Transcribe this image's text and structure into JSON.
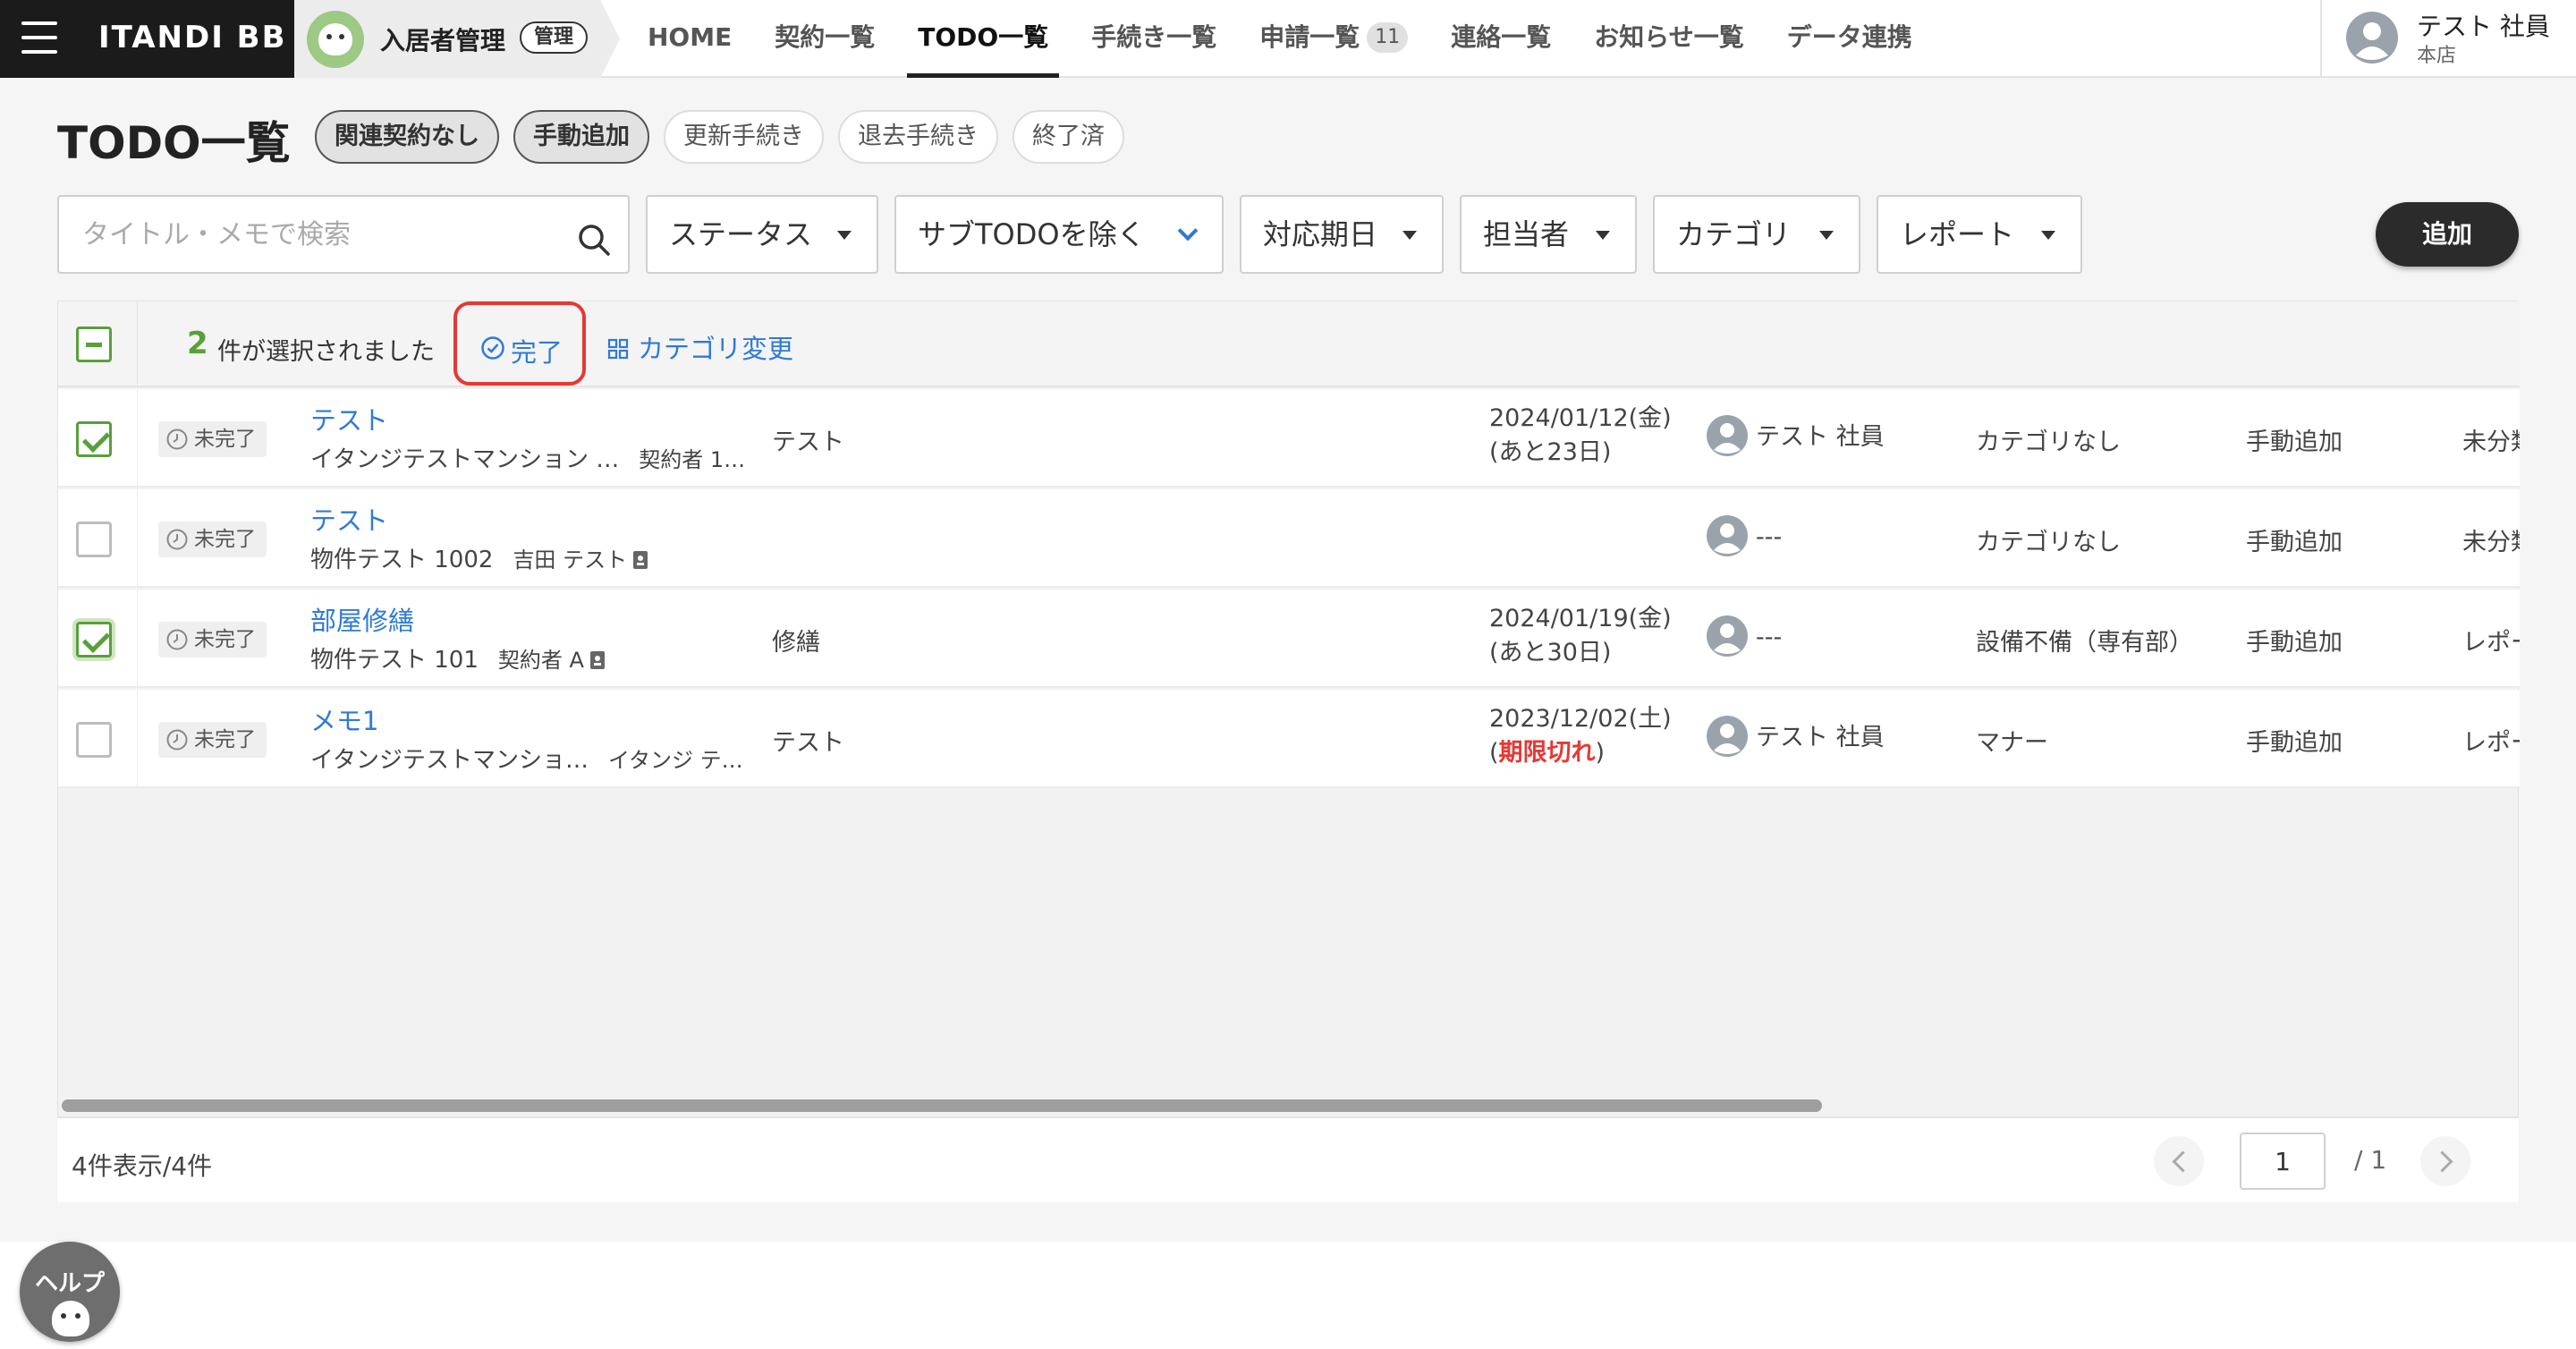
{
  "brand": {
    "logo": "ITANDI BB"
  },
  "app": {
    "name": "入居者管理",
    "badge": "管理"
  },
  "nav": {
    "items": [
      {
        "label": "HOME"
      },
      {
        "label": "契約一覧"
      },
      {
        "label": "TODO一覧",
        "active": true
      },
      {
        "label": "手続き一覧"
      },
      {
        "label": "申請一覧",
        "count": "11"
      },
      {
        "label": "連絡一覧"
      },
      {
        "label": "お知らせ一覧"
      },
      {
        "label": "データ連携"
      }
    ]
  },
  "user": {
    "name": "テスト 社員",
    "branch": "本店"
  },
  "page": {
    "title": "TODO一覧"
  },
  "quick_filters": [
    {
      "label": "関連契約なし",
      "on": true
    },
    {
      "label": "手動追加",
      "on": true
    },
    {
      "label": "更新手続き",
      "on": false
    },
    {
      "label": "退去手続き",
      "on": false
    },
    {
      "label": "終了済",
      "on": false
    }
  ],
  "search": {
    "placeholder": "タイトル・メモで検索",
    "value": ""
  },
  "filters": {
    "status": "ステータス",
    "subtodo": "サブTODOを除く",
    "due": "対応期日",
    "assignee": "担当者",
    "category": "カテゴリ",
    "report": "レポート"
  },
  "add_button": "追加",
  "bulk": {
    "selected_count": "2",
    "selected_text": "件が選択されました",
    "complete_label": "完了",
    "change_category_label": "カテゴリ変更"
  },
  "rows": [
    {
      "checked": true,
      "status": "未完了",
      "title": "テスト",
      "property": "イタンジテストマンション …",
      "tenant": "契約者 1…",
      "memo": "テスト",
      "due_date": "2024/01/12(金)",
      "due_note": "(あと23日)",
      "due_late": "",
      "assignee": "テスト 社員",
      "category": "カテゴリなし",
      "kind": "手動追加",
      "report": "未分類"
    },
    {
      "checked": false,
      "status": "未完了",
      "title": "テスト",
      "property": "物件テスト 1002",
      "tenant": "吉田 テスト",
      "memo": "",
      "due_date": "",
      "due_note": "",
      "due_late": "",
      "assignee": "---",
      "category": "カテゴリなし",
      "kind": "手動追加",
      "report": "未分類"
    },
    {
      "checked": true,
      "status": "未完了",
      "title": "部屋修繕",
      "property": "物件テスト 101",
      "tenant": "契約者 A",
      "memo": "修繕",
      "due_date": "2024/01/19(金)",
      "due_note": "(あと30日)",
      "due_late": "",
      "assignee": "---",
      "category": "設備不備（専有部）",
      "kind": "手動追加",
      "report": "レポート"
    },
    {
      "checked": false,
      "status": "未完了",
      "title": "メモ1",
      "property": "イタンジテストマンショ…",
      "tenant": "イタンジ テ…",
      "memo": "テスト",
      "due_date": "2023/12/02(土)",
      "due_note": "",
      "due_late": "期限切れ",
      "assignee": "テスト 社員",
      "category": "マナー",
      "kind": "手動追加",
      "report": "レポート"
    }
  ],
  "footer": {
    "count": "4件表示/4件",
    "page": "1",
    "total": "/ 1"
  },
  "help": {
    "label": "ヘルプ"
  },
  "colors": {
    "accent_link": "#2f7ad6",
    "check_green": "#58a03a",
    "highlight_red": "#e53935",
    "late_red": "#e53935",
    "brand_dark": "#1b1b1b"
  }
}
